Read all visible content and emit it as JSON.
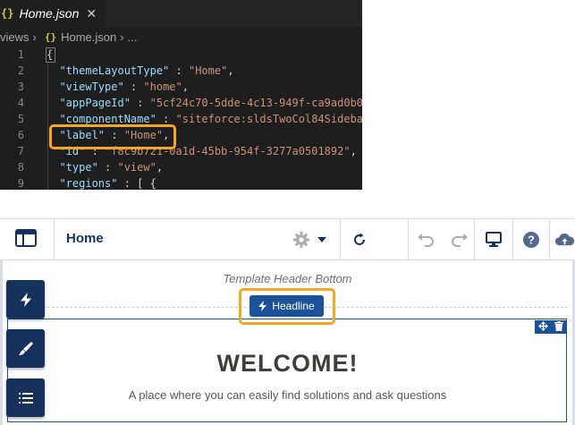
{
  "editor": {
    "tab": {
      "icon": "{}",
      "filename": "Home.json",
      "close": "✕"
    },
    "breadcrumb": {
      "parent": "views",
      "file_icon": "{}",
      "file": "Home.json",
      "more": "..."
    },
    "lines": [
      {
        "num": "1",
        "parts": [
          {
            "t": "{",
            "c": "p"
          }
        ]
      },
      {
        "num": "2",
        "parts": [
          {
            "t": "  \"themeLayoutType\"",
            "c": "k"
          },
          {
            "t": " : ",
            "c": "p"
          },
          {
            "t": "\"Home\"",
            "c": "s"
          },
          {
            "t": ",",
            "c": "p"
          }
        ]
      },
      {
        "num": "3",
        "parts": [
          {
            "t": "  \"viewType\"",
            "c": "k"
          },
          {
            "t": " : ",
            "c": "p"
          },
          {
            "t": "\"home\"",
            "c": "s"
          },
          {
            "t": ",",
            "c": "p"
          }
        ]
      },
      {
        "num": "4",
        "parts": [
          {
            "t": "  \"appPageId\"",
            "c": "k"
          },
          {
            "t": " : ",
            "c": "p"
          },
          {
            "t": "\"5cf24c70-5dde-4c13-949f-ca9ad0b0",
            "c": "s"
          }
        ]
      },
      {
        "num": "5",
        "parts": [
          {
            "t": "  \"componentName\"",
            "c": "k"
          },
          {
            "t": " : ",
            "c": "p"
          },
          {
            "t": "\"siteforce:sldsTwoCol84Sideba",
            "c": "s"
          }
        ]
      },
      {
        "num": "6",
        "parts": [
          {
            "t": "  \"label\"",
            "c": "k"
          },
          {
            "t": " : ",
            "c": "p"
          },
          {
            "t": "\"Home\"",
            "c": "s"
          },
          {
            "t": ",",
            "c": "p"
          }
        ]
      },
      {
        "num": "7",
        "parts": [
          {
            "t": "  \"id\"",
            "c": "k"
          },
          {
            "t": " : ",
            "c": "p"
          },
          {
            "t": "\"f8c9b721-0a1d-45bb-954f-3277a0501892\"",
            "c": "s"
          },
          {
            "t": ",",
            "c": "p"
          }
        ]
      },
      {
        "num": "8",
        "parts": [
          {
            "t": "  \"type\"",
            "c": "k"
          },
          {
            "t": " : ",
            "c": "p"
          },
          {
            "t": "\"view\"",
            "c": "s"
          },
          {
            "t": ",",
            "c": "p"
          }
        ]
      },
      {
        "num": "9",
        "parts": [
          {
            "t": "  \"regions\"",
            "c": "k"
          },
          {
            "t": " : [ {",
            "c": "p"
          }
        ]
      }
    ]
  },
  "builder": {
    "page_name": "Home",
    "template_label": "Template Header Bottom",
    "headline_label": "Headline",
    "welcome": "WELCOME!",
    "tagline": "A place where you can easily find solutions and ask questions",
    "help_glyph": "?"
  },
  "colors": {
    "navy": "#16325c",
    "component_blue": "#1b5297",
    "highlight_orange": "#f5a623",
    "editor_bg": "#1e1e1e",
    "json_key": "#9cdcfe",
    "json_string": "#ce9178"
  },
  "icons": [
    "json-file-icon",
    "close-icon",
    "chevron-right-icon",
    "builder-logo-icon",
    "gear-icon",
    "caret-down-icon",
    "refresh-icon",
    "undo-icon",
    "redo-icon",
    "desktop-icon",
    "help-icon",
    "cloud-upload-icon",
    "move-icon",
    "delete-icon",
    "lightning-icon",
    "brush-icon",
    "list-icon"
  ]
}
